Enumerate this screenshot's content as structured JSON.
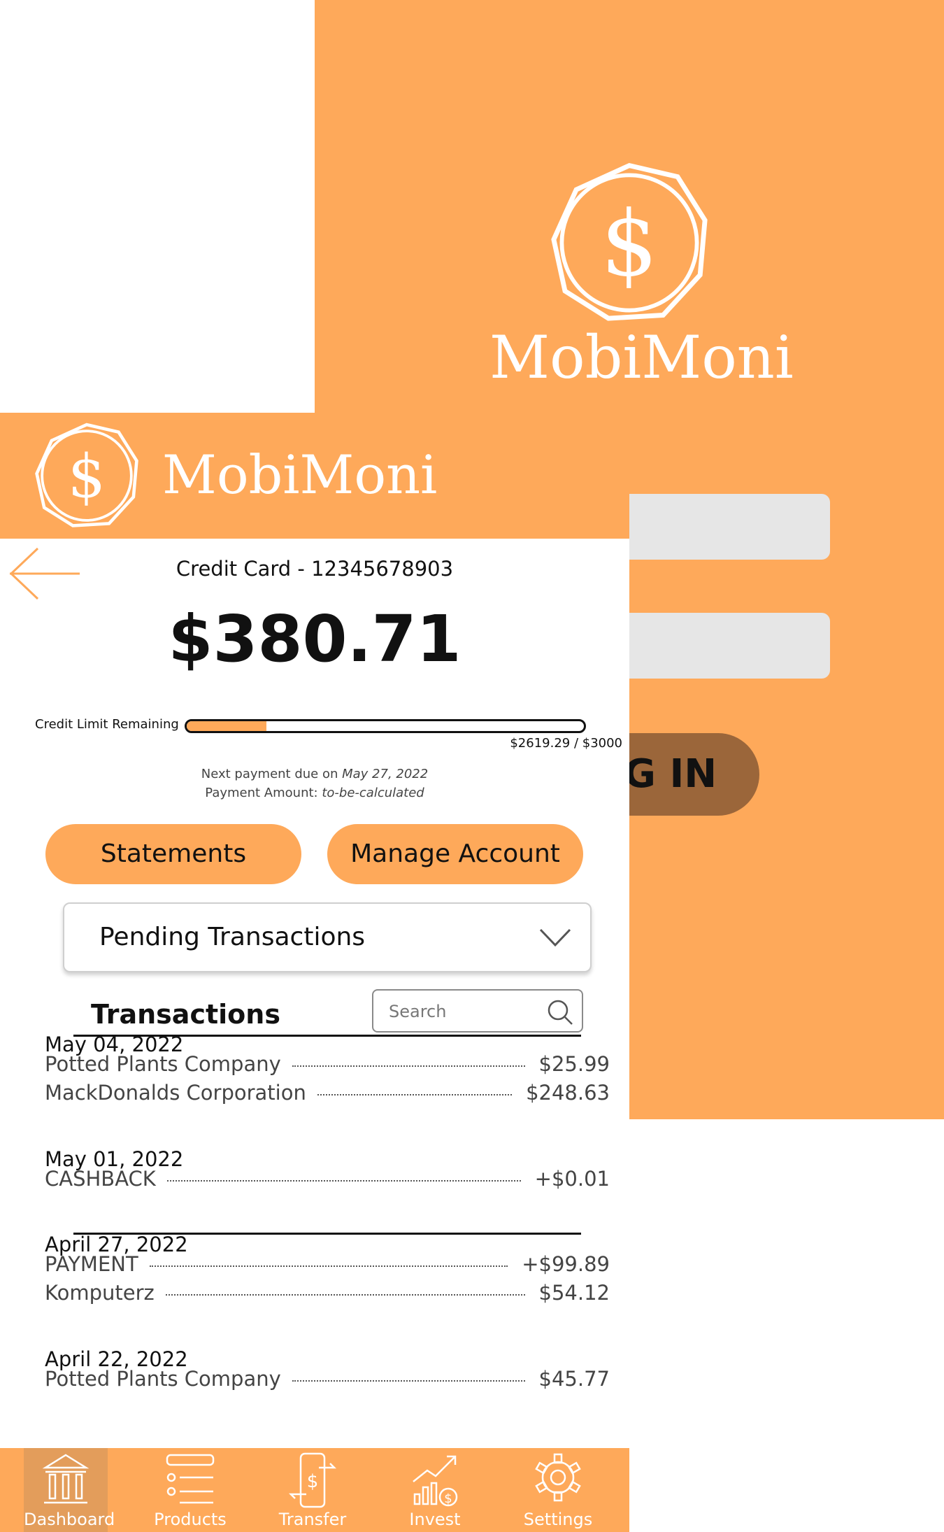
{
  "brand": {
    "name": "MobiMoni",
    "colors": {
      "primary": "#fea95a",
      "login_button": "#9b663a",
      "field": "#e6e6e6"
    }
  },
  "login_screen": {
    "login_button_label": "G IN"
  },
  "card": {
    "title": "Credit Card - 12345678903",
    "balance": "$380.71",
    "credit_limit_label": "Credit Limit Remaining",
    "credit_limit_amount": "$2619.29 / $3000",
    "credit_limit_fill_fraction": 0.2,
    "next_payment_prefix": "Next payment due on ",
    "next_payment_date": "May 27, 2022",
    "payment_amount_prefix": "Payment Amount: ",
    "payment_amount_value": "to-be-calculated"
  },
  "actions": {
    "statements_label": "Statements",
    "manage_label": "Manage Account"
  },
  "pending_select": {
    "selected": "Pending Transactions"
  },
  "transactions": {
    "heading": "Transactions",
    "search_placeholder": "Search",
    "groups": [
      {
        "date": "May 04, 2022",
        "items": [
          {
            "merchant": "Potted Plants Company",
            "amount": "$25.99"
          },
          {
            "merchant": "MackDonalds Corporation",
            "amount": "$248.63"
          }
        ]
      },
      {
        "date": "May 01, 2022",
        "items": [
          {
            "merchant": "CASHBACK",
            "amount": "+$0.01"
          }
        ]
      },
      {
        "date": "April 27, 2022",
        "items": [
          {
            "merchant": "PAYMENT",
            "amount": "+$99.89"
          },
          {
            "merchant": "Komputerz",
            "amount": "$54.12"
          }
        ]
      },
      {
        "date": "April 22, 2022",
        "items": [
          {
            "merchant": "Potted Plants Company",
            "amount": "$45.77"
          }
        ]
      }
    ]
  },
  "nav": {
    "items": [
      {
        "label": "Dashboard",
        "icon": "bank-icon",
        "active": true
      },
      {
        "label": "Products",
        "icon": "list-icon",
        "active": false
      },
      {
        "label": "Transfer",
        "icon": "transfer-icon",
        "active": false
      },
      {
        "label": "Invest",
        "icon": "invest-icon",
        "active": false
      },
      {
        "label": "Settings",
        "icon": "gear-icon",
        "active": false
      }
    ]
  }
}
